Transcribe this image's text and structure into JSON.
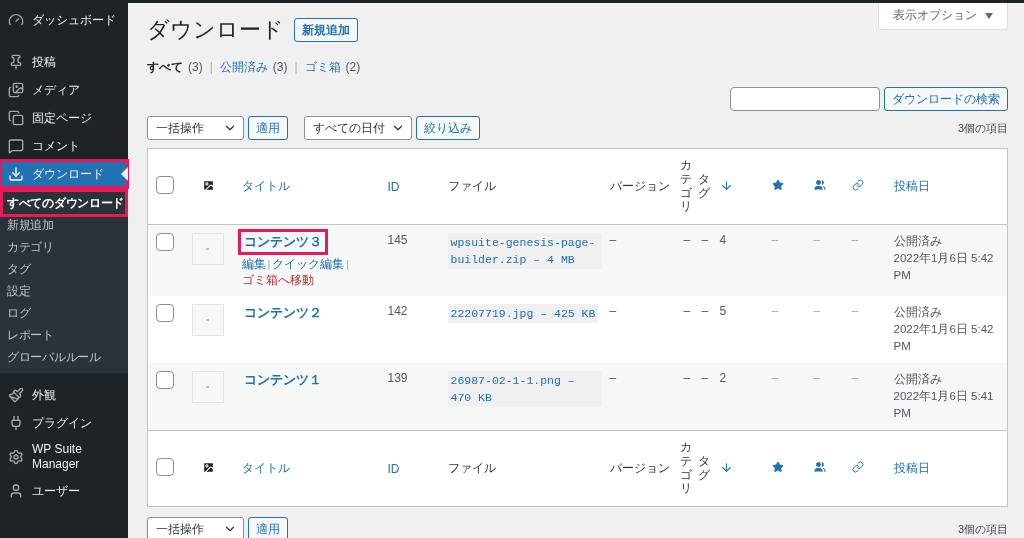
{
  "sidebar": {
    "items": [
      {
        "label": "ダッシュボード",
        "selected": false,
        "annotated": false
      },
      {
        "label": "投稿",
        "selected": false,
        "annotated": false
      },
      {
        "label": "メディア",
        "selected": false,
        "annotated": false
      },
      {
        "label": "固定ページ",
        "selected": false,
        "annotated": false
      },
      {
        "label": "コメント",
        "selected": false,
        "annotated": false
      },
      {
        "label": "ダウンロード",
        "selected": true,
        "annotated": true,
        "children": [
          {
            "label": "すべてのダウンロード",
            "selected": true,
            "annotated": true
          },
          {
            "label": "新規追加",
            "selected": false,
            "annotated": false
          },
          {
            "label": "カテゴリ",
            "selected": false,
            "annotated": false
          },
          {
            "label": "タグ",
            "selected": false,
            "annotated": false
          },
          {
            "label": "設定",
            "selected": false,
            "annotated": false
          },
          {
            "label": "ログ",
            "selected": false,
            "annotated": false
          },
          {
            "label": "レポート",
            "selected": false,
            "annotated": false
          },
          {
            "label": "グローバルルール",
            "selected": false,
            "annotated": false
          }
        ]
      },
      {
        "label": "外観",
        "selected": false,
        "annotated": false
      },
      {
        "label": "プラグイン",
        "selected": false,
        "annotated": false
      },
      {
        "label": "WP Suite Manager",
        "selected": false,
        "annotated": false
      },
      {
        "label": "ユーザー",
        "selected": false,
        "annotated": false
      }
    ]
  },
  "page": {
    "title": "ダウンロード",
    "add_new": "新規追加",
    "screen_options": "表示オプション"
  },
  "views": [
    {
      "label": "すべて",
      "count": "(3)",
      "selected": true
    },
    {
      "label": "公開済み",
      "count": "(3)",
      "selected": false,
      "separator": "|"
    },
    {
      "label": "ゴミ箱",
      "count": "(2)",
      "selected": false,
      "separator": "|"
    }
  ],
  "search": {
    "button": "ダウンロードの検索"
  },
  "top_nav": {
    "bulk_select": "一括操作",
    "apply": "適用",
    "date_select": "すべての日付",
    "filter": "絞り込み",
    "count": "3個の項目"
  },
  "table": {
    "header": [
      {
        "kind": "checkbox",
        "checked": false
      },
      {
        "kind": "thumbnail"
      },
      {
        "kind": "link",
        "label": "タイトル"
      },
      {
        "kind": "link",
        "label": "ID"
      },
      {
        "kind": "text",
        "label": "ファイル"
      },
      {
        "kind": "text",
        "label": "バージョン"
      },
      {
        "kind": "vertical",
        "label": "カテゴリ"
      },
      {
        "kind": "vertical",
        "label": "タグ"
      },
      {
        "kind": "sort"
      },
      {
        "kind": "star"
      },
      {
        "kind": "people"
      },
      {
        "kind": "chain"
      },
      {
        "kind": "link",
        "label": "投稿日"
      }
    ],
    "rows": [
      {
        "checked": false,
        "title": "コンテンツ３",
        "annotated": true,
        "actions": [
          {
            "label": "編集",
            "kind": "edit"
          },
          {
            "label": "クイック編集",
            "kind": "edit",
            "separator": "|"
          },
          {
            "label": "ゴミ箱へ移動",
            "kind": "delete",
            "separator": "|"
          }
        ],
        "id": "145",
        "file": "wpsuite-genesis-page-builder.zip – 4 MB",
        "version": "–",
        "category": "–",
        "tags": "–",
        "downloads": "4",
        "featured": "–",
        "members": "–",
        "redirect": "–",
        "status": "公開済み",
        "date": "2022年1月6日 5:42 PM"
      },
      {
        "checked": false,
        "title": "コンテンツ２",
        "annotated": false,
        "id": "142",
        "file": "22207719.jpg – 425 KB",
        "version": "–",
        "category": "–",
        "tags": "–",
        "downloads": "5",
        "featured": "–",
        "members": "–",
        "redirect": "–",
        "status": "公開済み",
        "date": "2022年1月6日 5:42 PM"
      },
      {
        "checked": false,
        "title": "コンテンツ１",
        "annotated": false,
        "id": "139",
        "file": "26987-02-1-1.png – 470 KB",
        "version": "–",
        "category": "–",
        "tags": "–",
        "downloads": "2",
        "featured": "–",
        "members": "–",
        "redirect": "–",
        "status": "公開済み",
        "date": "2022年1月6日 5:41 PM"
      }
    ],
    "footer": [
      {
        "kind": "checkbox",
        "checked": false
      },
      {
        "kind": "thumbnail"
      },
      {
        "kind": "link",
        "label": "タイトル"
      },
      {
        "kind": "link",
        "label": "ID"
      },
      {
        "kind": "text",
        "label": "ファイル"
      },
      {
        "kind": "text",
        "label": "バージョン"
      },
      {
        "kind": "vertical",
        "label": "カテゴリ"
      },
      {
        "kind": "vertical",
        "label": "タグ"
      },
      {
        "kind": "sort"
      },
      {
        "kind": "star"
      },
      {
        "kind": "people"
      },
      {
        "kind": "chain"
      },
      {
        "kind": "link",
        "label": "投稿日"
      }
    ]
  },
  "bottom_nav": {
    "bulk_select": "一括操作",
    "apply": "適用",
    "count": "3個の項目"
  }
}
